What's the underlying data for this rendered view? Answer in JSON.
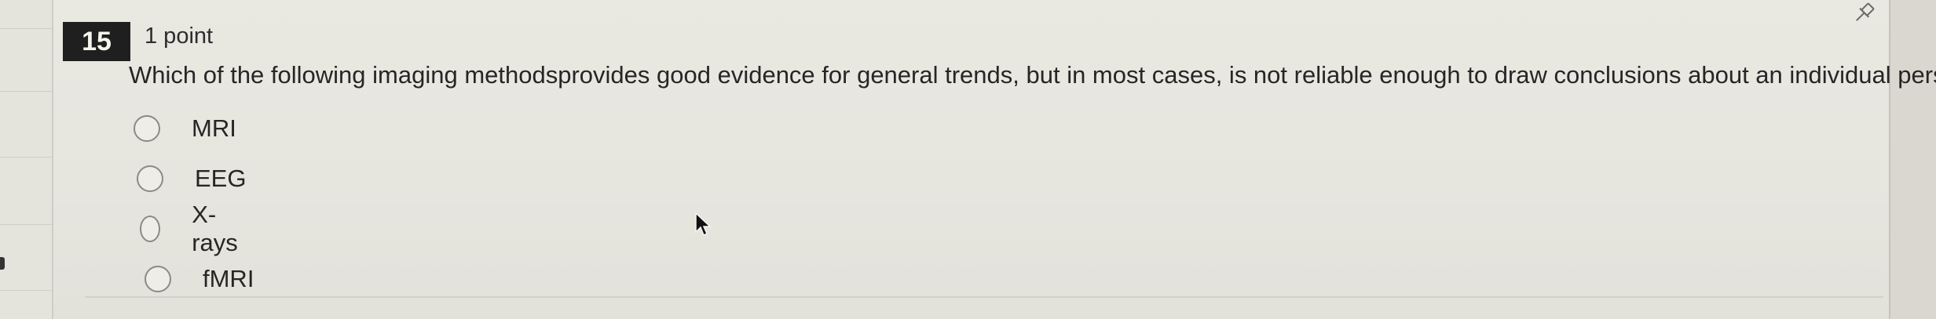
{
  "question": {
    "number": "15",
    "points": "1 point",
    "prompt": "Which of the following imaging methodsprovides good evidence for general trends, but in most cases, is not reliable enough to draw conclusions about an individual person?",
    "answers": [
      {
        "label": "MRI",
        "selected": false
      },
      {
        "label": "EEG",
        "selected": false
      },
      {
        "label": "X-rays",
        "selected": false
      },
      {
        "label": "fMRI",
        "selected": false
      }
    ]
  },
  "icons": {
    "pin": "pushpin-icon",
    "cursor": "mouse-pointer-icon"
  }
}
